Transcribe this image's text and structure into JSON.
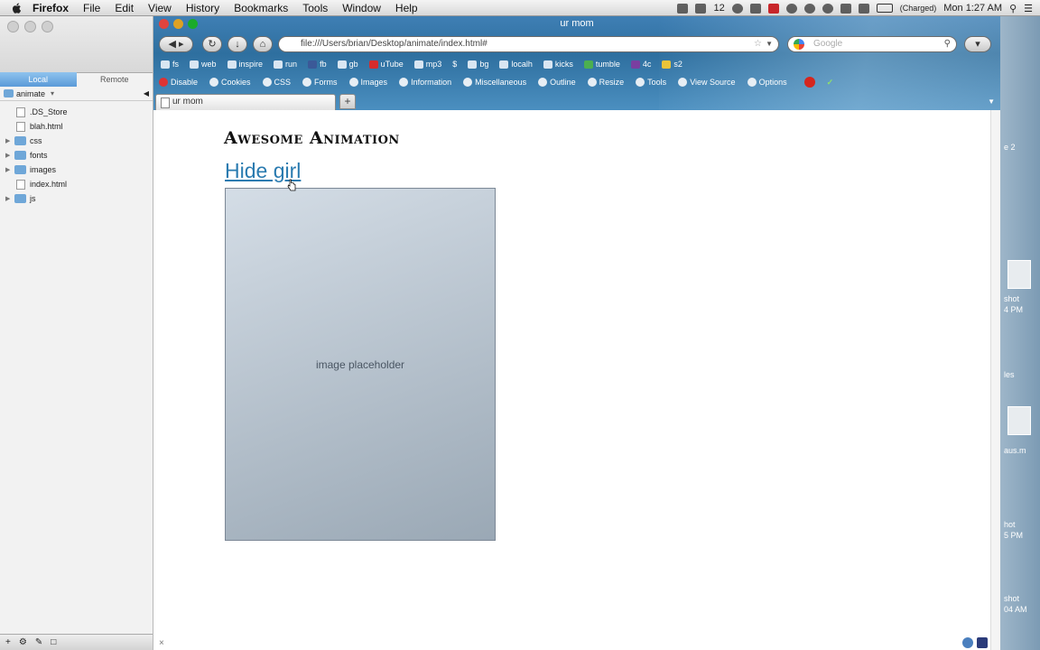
{
  "menubar": {
    "app": "Firefox",
    "items": [
      "File",
      "Edit",
      "View",
      "History",
      "Bookmarks",
      "Tools",
      "Window",
      "Help"
    ],
    "badge_count": "12",
    "battery": "(Charged)",
    "clock": "Mon 1:27 AM"
  },
  "ftp_panel": {
    "tabs": [
      "Local",
      "Remote"
    ],
    "folder": "animate",
    "files": [
      {
        "name": ".DS_Store",
        "type": "file"
      },
      {
        "name": "blah.html",
        "type": "file"
      },
      {
        "name": "css",
        "type": "folder"
      },
      {
        "name": "fonts",
        "type": "folder"
      },
      {
        "name": "images",
        "type": "folder"
      },
      {
        "name": "index.html",
        "type": "file"
      },
      {
        "name": "js",
        "type": "folder"
      }
    ]
  },
  "browser": {
    "window_title": "ur mom",
    "url": "file:///Users/brian/Desktop/animate/index.html#",
    "search_placeholder": "Google",
    "bookmarks": [
      "fs",
      "web",
      "inspire",
      "run",
      "fb",
      "gb",
      "uTube",
      "mp3",
      "$",
      "bg",
      "localh",
      "kicks",
      "tumble",
      "4c",
      "s2"
    ],
    "devbar": [
      "Disable",
      "Cookies",
      "CSS",
      "Forms",
      "Images",
      "Information",
      "Miscellaneous",
      "Outline",
      "Resize",
      "Tools",
      "View Source",
      "Options"
    ],
    "tab_title": "ur mom",
    "new_tab": "+"
  },
  "page": {
    "title": "Awesome Animation",
    "link": "Hide girl",
    "image_label": "image placeholder"
  },
  "desktop": {
    "labels": [
      "e 2",
      "shot",
      "4 PM",
      "les",
      "aus.m",
      "hot",
      "5 PM",
      "shot",
      "04 AM"
    ]
  }
}
